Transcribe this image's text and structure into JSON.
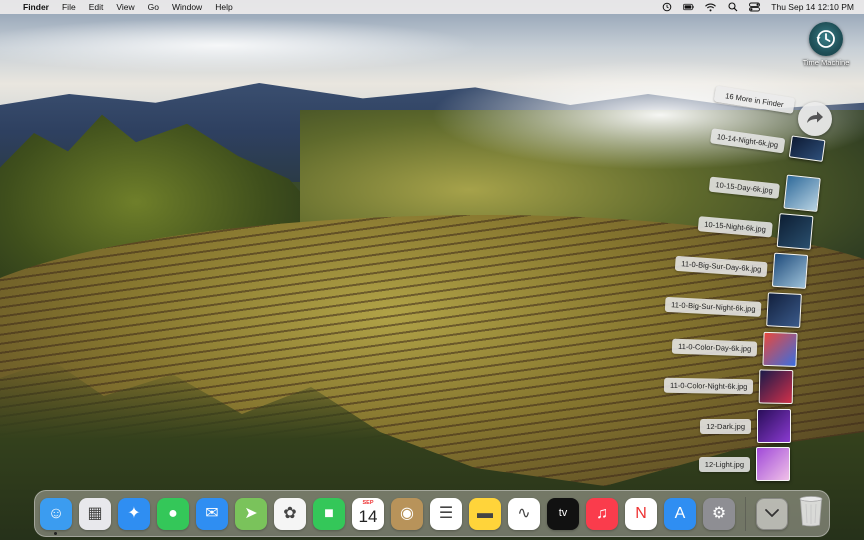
{
  "menubar": {
    "apple_glyph": "",
    "app_name": "Finder",
    "menus": [
      "File",
      "Edit",
      "View",
      "Go",
      "Window",
      "Help"
    ],
    "status_icons": [
      "time-machine-icon",
      "battery-icon",
      "wifi-icon",
      "search-icon",
      "control-center-icon"
    ],
    "clock": "Thu Sep 14  12:10 PM"
  },
  "desktop": {
    "items": [
      {
        "label": "Time Machine",
        "icon": "time-machine-icon"
      }
    ]
  },
  "stack": {
    "more_label": "16 More in Finder",
    "open_icon": "arrow-forward-icon",
    "items": [
      {
        "label": "10-14-Night-6k.jpg",
        "colors": [
          "#0d1a33",
          "#2e4f7a"
        ]
      },
      {
        "label": "10-15-Day-6k.jpg",
        "colors": [
          "#2f6a9a",
          "#b8d3e3"
        ]
      },
      {
        "label": "10-15-Night-6k.jpg",
        "colors": [
          "#0d1e33",
          "#2a4f6e"
        ]
      },
      {
        "label": "11-0-Big-Sur-Day-6k.jpg",
        "colors": [
          "#1e4a7a",
          "#9ec2d9"
        ]
      },
      {
        "label": "11-0-Big-Sur-Night-6k.jpg",
        "colors": [
          "#12203d",
          "#3a5a8a"
        ]
      },
      {
        "label": "11-0-Color-Day-6k.jpg",
        "colors": [
          "#e8483c",
          "#3a6ee0"
        ]
      },
      {
        "label": "11-0-Color-Night-6k.jpg",
        "colors": [
          "#1a1a4a",
          "#d0304a"
        ]
      },
      {
        "label": "12-Dark.jpg",
        "colors": [
          "#2a0e5a",
          "#8a3ad0"
        ]
      },
      {
        "label": "12-Light.jpg",
        "colors": [
          "#a04ad8",
          "#f0c0e8"
        ]
      }
    ]
  },
  "dock": {
    "apps": [
      {
        "name": "finder",
        "icon": "finder-icon",
        "bg": "#3b9cf0",
        "glyph": "☺",
        "running": true
      },
      {
        "name": "launchpad",
        "icon": "launchpad-icon",
        "bg": "#e8e8ec",
        "glyph": "▦",
        "running": false
      },
      {
        "name": "safari",
        "icon": "safari-icon",
        "bg": "#2f8ef2",
        "glyph": "✦",
        "running": false
      },
      {
        "name": "messages",
        "icon": "messages-icon",
        "bg": "#34c759",
        "glyph": "●",
        "running": false
      },
      {
        "name": "mail",
        "icon": "mail-icon",
        "bg": "#2f8ef2",
        "glyph": "✉",
        "running": false
      },
      {
        "name": "maps",
        "icon": "maps-icon",
        "bg": "#7ac35b",
        "glyph": "➤",
        "running": false
      },
      {
        "name": "photos",
        "icon": "photos-icon",
        "bg": "#f5f5f5",
        "glyph": "✿",
        "running": false
      },
      {
        "name": "facetime",
        "icon": "facetime-icon",
        "bg": "#34c759",
        "glyph": "■",
        "running": false
      },
      {
        "name": "calendar",
        "icon": "calendar-icon",
        "bg": "#ffffff",
        "month": "SEP",
        "day": "14",
        "running": false
      },
      {
        "name": "contacts",
        "icon": "contacts-icon",
        "bg": "#b8935a",
        "glyph": "◉",
        "running": false
      },
      {
        "name": "reminders",
        "icon": "reminders-icon",
        "bg": "#ffffff",
        "glyph": "☰",
        "running": false
      },
      {
        "name": "notes",
        "icon": "notes-icon",
        "bg": "#ffd43a",
        "glyph": "▬",
        "running": false
      },
      {
        "name": "freeform",
        "icon": "freeform-icon",
        "bg": "#ffffff",
        "glyph": "∿",
        "running": false
      },
      {
        "name": "apple-tv",
        "icon": "apple-tv-icon",
        "bg": "#111111",
        "glyph": "tv",
        "running": false
      },
      {
        "name": "music",
        "icon": "music-icon",
        "bg": "#fa3c4c",
        "glyph": "♫",
        "running": false
      },
      {
        "name": "news",
        "icon": "news-icon",
        "bg": "#ffffff",
        "glyph": "N",
        "running": false
      },
      {
        "name": "app-store",
        "icon": "app-store-icon",
        "bg": "#2f8ef2",
        "glyph": "A",
        "running": false
      },
      {
        "name": "system-settings",
        "icon": "system-settings-icon",
        "bg": "#8e8e93",
        "glyph": "⚙",
        "running": false
      }
    ],
    "stack_icon": "chevron-down-icon",
    "trash_icon": "trash-icon"
  }
}
